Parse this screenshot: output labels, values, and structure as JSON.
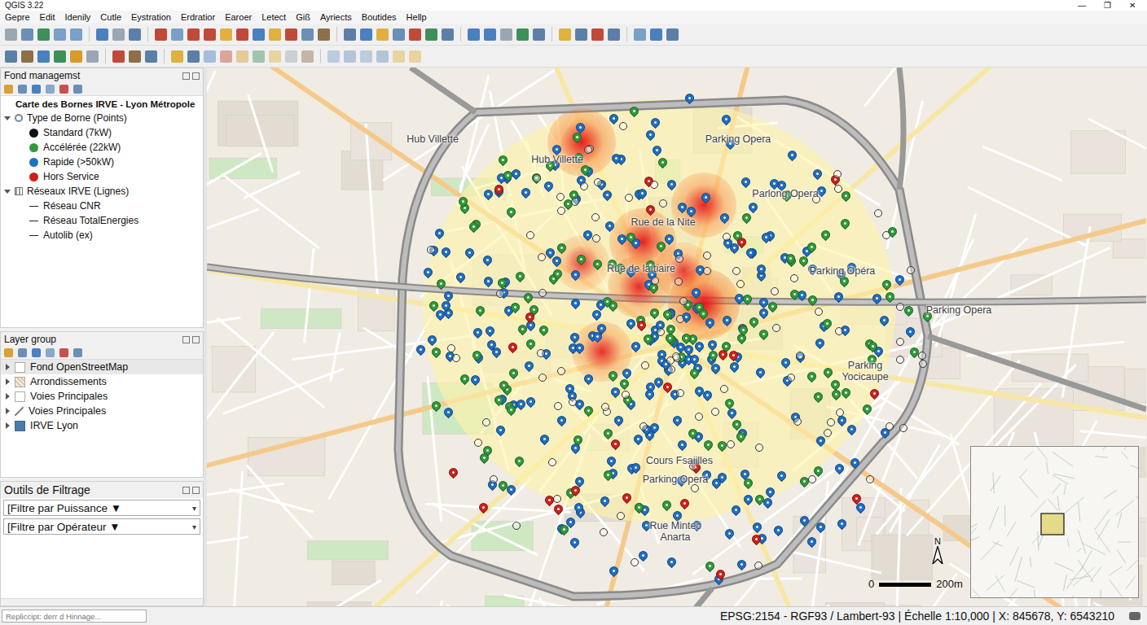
{
  "window": {
    "title": "QGIS 3.22",
    "controls": [
      "—",
      "❐",
      "✕"
    ]
  },
  "menu": [
    "Gepre",
    "Edit",
    "Idenily",
    "Cutle",
    "Eystration",
    "Erdratior",
    "Earoer",
    "Letect",
    "Giß",
    "Ayriects",
    "Boutides",
    "Hellp"
  ],
  "layers_panel": {
    "title": "Fond managemst",
    "map_title": "Carte des Bornes IRVE - Lyon Métropole",
    "groups": [
      {
        "label": "Type de Borne (Points)",
        "expanded": true,
        "kind": "point",
        "items": [
          {
            "label": "Standard (7kW)",
            "color": "#111111"
          },
          {
            "label": "Accélérée (22kW)",
            "color": "#2f9a3a"
          },
          {
            "label": "Rapide (>50kW)",
            "color": "#1f6fc5"
          },
          {
            "label": "Hors Service",
            "color": "#d0201c"
          }
        ]
      },
      {
        "label": "Réseaux IRVE (Lignes)",
        "expanded": true,
        "kind": "line",
        "items": [
          {
            "label": "Réseau CNR"
          },
          {
            "label": "Réseau TotalEnergies"
          },
          {
            "label": "Autolib (ex)"
          }
        ]
      }
    ]
  },
  "layer_group": {
    "title": "Layer group",
    "items": [
      {
        "label": "Fond OpenStreetMap",
        "kind": "raster",
        "expanded": false,
        "selected": true
      },
      {
        "label": "Arrondissements",
        "kind": "polygon",
        "expanded": false,
        "selected": false
      },
      {
        "label": "Voies Principales",
        "kind": "raster",
        "expanded": false,
        "selected": false
      },
      {
        "label": "Voies Principales",
        "kind": "line",
        "expanded": false,
        "selected": false
      },
      {
        "label": "IRVE Lyon",
        "kind": "point",
        "expanded": false,
        "selected": false
      }
    ]
  },
  "filters": {
    "title": "Outils de Filtrage",
    "dropdowns": [
      {
        "label": "[Filtre par Puissance ▼",
        "arrow": "▾"
      },
      {
        "label": "[Filtre par Opérateur ▼",
        "arrow": "▾"
      }
    ]
  },
  "locator": {
    "placeholder": "Repliccipt: derr d Hinnage..."
  },
  "map": {
    "labels": [
      "Hub Villette",
      "Hub Villette",
      "Parking Opera",
      "Parlong Opera",
      "Rue de la Nite",
      "Rue de la tiaire",
      "Parking Opéra",
      "Parking Opera",
      "Parking Yocicaupe",
      "Cours Fsaiilles",
      "Parking Opera",
      "Rue Mintec Anarta"
    ],
    "heat_spots": [
      {
        "level": 0.9
      },
      {
        "level": 0.8
      },
      {
        "level": 0.85
      },
      {
        "level": 0.75
      },
      {
        "level": 1.0
      },
      {
        "level": 0.7
      },
      {
        "level": 0.6
      },
      {
        "level": 0.55
      }
    ],
    "pin_groups": [
      {
        "type": "Rapide",
        "kind": "pin",
        "color": "#1f6fc5",
        "count": "230"
      },
      {
        "type": "Accélérée",
        "kind": "pin",
        "color": "#2f9a3a",
        "count": "130"
      },
      {
        "type": "Hors Service",
        "kind": "pin",
        "color": "#d0201c",
        "count": "24"
      },
      {
        "type": "Standard",
        "kind": "ring",
        "color": "#333333",
        "count": "90"
      }
    ],
    "scale": {
      "start": "0",
      "end": "200m"
    },
    "north": "N"
  },
  "status_bar": "EPSG:2154 - RGF93 / Lambert-93 | Échelle 1:10,000 | X: 845678, Y: 6543210"
}
